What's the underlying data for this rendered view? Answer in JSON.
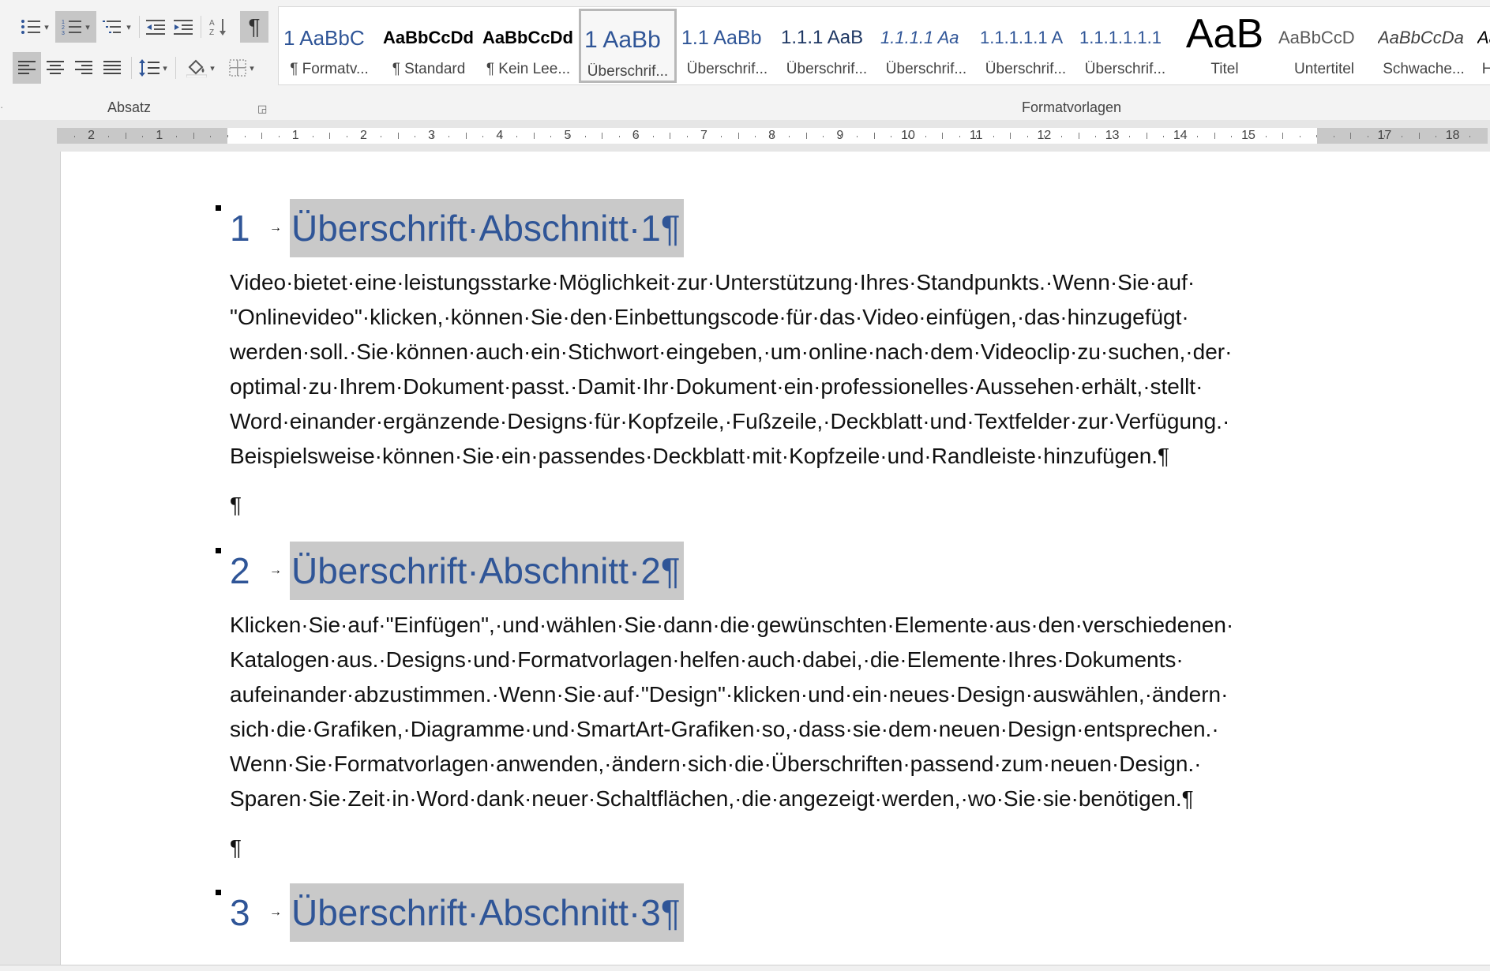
{
  "ribbon": {
    "paragraph_group_label": "Absatz",
    "styles_group_label": "Formatvorlagen",
    "paragraph_buttons": [
      {
        "name": "bullets-button",
        "icon": "bullet-list-icon"
      },
      {
        "name": "numbering-button",
        "icon": "numbered-list-icon",
        "active": true
      },
      {
        "name": "multilevel-list-button",
        "icon": "multilevel-list-icon"
      },
      {
        "name": "decrease-indent-button",
        "icon": "decrease-indent-icon"
      },
      {
        "name": "increase-indent-button",
        "icon": "increase-indent-icon"
      },
      {
        "name": "sort-button",
        "icon": "sort-icon"
      },
      {
        "name": "show-formatting-button",
        "icon": "pilcrow-icon",
        "active": true
      },
      {
        "name": "align-left-button",
        "icon": "align-left-icon",
        "active": true
      },
      {
        "name": "align-center-button",
        "icon": "align-center-icon"
      },
      {
        "name": "align-right-button",
        "icon": "align-right-icon"
      },
      {
        "name": "justify-button",
        "icon": "justify-icon"
      },
      {
        "name": "line-spacing-button",
        "icon": "line-spacing-icon"
      },
      {
        "name": "shading-button",
        "icon": "paint-bucket-icon"
      },
      {
        "name": "borders-button",
        "icon": "borders-icon"
      }
    ],
    "pilcrow_glyph": "¶",
    "styles": [
      {
        "preview": "1  AaBbC",
        "name": "¶ Formatv...",
        "color": "#2f5597",
        "size": 26
      },
      {
        "preview": "AaBbCcDd",
        "name": "¶ Standard",
        "color": "#000000",
        "size": 22,
        "bold": true
      },
      {
        "preview": "AaBbCcDd",
        "name": "¶ Kein Lee...",
        "color": "#000000",
        "size": 22,
        "bold": true
      },
      {
        "preview": "1  AaBb",
        "name": "Überschrif...",
        "color": "#2f5597",
        "size": 30,
        "selected": true
      },
      {
        "preview": "1.1  AaBb",
        "name": "Überschrif...",
        "color": "#2f5597",
        "size": 25
      },
      {
        "preview": "1.1.1  AaB",
        "name": "Überschrif...",
        "color": "#1f3864",
        "size": 24
      },
      {
        "preview": "1.1.1.1  Aa",
        "name": "Überschrif...",
        "color": "#2f5597",
        "size": 22,
        "italic": true
      },
      {
        "preview": "1.1.1.1.1  A",
        "name": "Überschrif...",
        "color": "#2f5597",
        "size": 22
      },
      {
        "preview": "1.1.1.1.1.1",
        "name": "Überschrif...",
        "color": "#2f5597",
        "size": 22
      },
      {
        "preview": "AaB",
        "name": "Titel",
        "color": "#000000",
        "size": 52
      },
      {
        "preview": "AaBbCcD",
        "name": "Untertitel",
        "color": "#595959",
        "size": 22
      },
      {
        "preview": "AaBbCcDa",
        "name": "Schwache...",
        "color": "#404040",
        "size": 22,
        "italic": true
      },
      {
        "preview": "AaBbCcDa",
        "name": "Hervorheb...",
        "color": "#000000",
        "size": 22,
        "italic": true
      }
    ],
    "dialog_launcher": "◲"
  },
  "ruler": {
    "left_numbers": [
      "2",
      "1"
    ],
    "right_numbers": [
      "1",
      "2",
      "3",
      "4",
      "5",
      "6",
      "7",
      "8",
      "9",
      "10",
      "11",
      "12",
      "13",
      "14",
      "15",
      "17",
      "18"
    ]
  },
  "document": {
    "sections": [
      {
        "number": "1",
        "tab_arrow": "→",
        "heading": "Überschrift·Abschnitt·1¶",
        "lines": [
          "Video·bietet·eine·leistungsstarke·Möglichkeit·zur·Unterstützung·Ihres·Standpunkts.·Wenn·Sie·auf·",
          "\"Onlinevideo\"·klicken,·können·Sie·den·Einbettungscode·für·das·Video·einfügen,·das·hinzugefügt·",
          "werden·soll.·Sie·können·auch·ein·Stichwort·eingeben,·um·online·nach·dem·Videoclip·zu·suchen,·der·",
          "optimal·zu·Ihrem·Dokument·passt.·Damit·Ihr·Dokument·ein·professionelles·Aussehen·erhält,·stellt·",
          "Word·einander·ergänzende·Designs·für·Kopfzeile,·Fußzeile,·Deckblatt·und·Textfelder·zur·Verfügung.·",
          "Beispielsweise·können·Sie·ein·passendes·Deckblatt·mit·Kopfzeile·und·Randleiste·hinzufügen.¶"
        ],
        "empty_paragraph": "¶"
      },
      {
        "number": "2",
        "tab_arrow": "→",
        "heading": "Überschrift·Abschnitt·2¶",
        "lines": [
          "Klicken·Sie·auf·\"Einfügen\",·und·wählen·Sie·dann·die·gewünschten·Elemente·aus·den·verschiedenen·",
          "Katalogen·aus.·Designs·und·Formatvorlagen·helfen·auch·dabei,·die·Elemente·Ihres·Dokuments·",
          "aufeinander·abzustimmen.·Wenn·Sie·auf·\"Design\"·klicken·und·ein·neues·Design·auswählen,·ändern·",
          "sich·die·Grafiken,·Diagramme·und·SmartArt-Grafiken·so,·dass·sie·dem·neuen·Design·entsprechen.·",
          "Wenn·Sie·Formatvorlagen·anwenden,·ändern·sich·die·Überschriften·passend·zum·neuen·Design.·",
          "Sparen·Sie·Zeit·in·Word·dank·neuer·Schaltflächen,·die·angezeigt·werden,·wo·Sie·sie·benötigen.¶"
        ],
        "empty_paragraph": "¶"
      },
      {
        "number": "3",
        "tab_arrow": "→",
        "heading": "Überschrift·Abschnitt·3¶",
        "lines": []
      }
    ]
  }
}
